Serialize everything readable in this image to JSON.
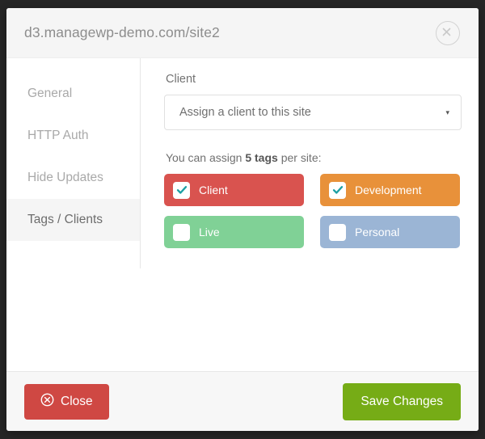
{
  "modal": {
    "title": "d3.managewp-demo.com/site2",
    "close_icon": "close-circle-icon"
  },
  "sidebar": {
    "items": [
      {
        "label": "General",
        "active": false
      },
      {
        "label": "HTTP Auth",
        "active": false
      },
      {
        "label": "Hide Updates",
        "active": false
      },
      {
        "label": "Tags / Clients",
        "active": true
      }
    ]
  },
  "content": {
    "client_label": "Client",
    "client_select": {
      "value": "Assign a client to this site",
      "chevron": "▾"
    },
    "tags_note_prefix": "You can assign ",
    "tags_note_strong": "5 tags",
    "tags_note_suffix": " per site:",
    "tags": [
      {
        "label": "Client",
        "checked": true,
        "color": "#d9534f"
      },
      {
        "label": "Development",
        "checked": true,
        "color": "#e8913a"
      },
      {
        "label": "Live",
        "checked": false,
        "color": "#80d196"
      },
      {
        "label": "Personal",
        "checked": false,
        "color": "#9bb5d5"
      }
    ],
    "checkmark_color": "#1b9fa3"
  },
  "footer": {
    "close_label": "Close",
    "close_icon": "circle-x-icon",
    "close_color": "#cf4843",
    "save_label": "Save Changes",
    "save_color": "#76ac16"
  }
}
